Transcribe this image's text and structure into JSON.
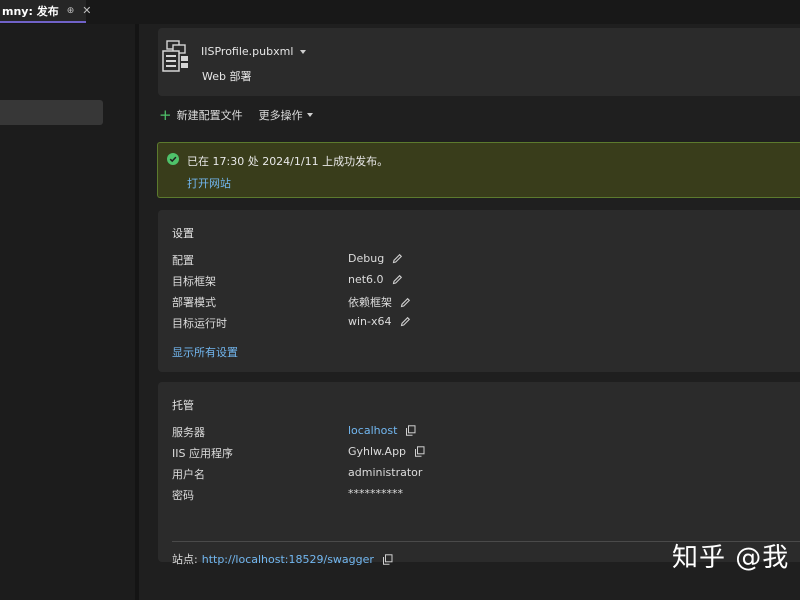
{
  "tab": {
    "title": "mny: 发布",
    "pin_glyph": "⊕",
    "close_glyph": "✕"
  },
  "profile": {
    "name": "IISProfile.pubxml",
    "subtitle": "Web 部署"
  },
  "toolbar": {
    "new_profile_label": "新建配置文件",
    "more_actions_label": "更多操作"
  },
  "status": {
    "message": "已在 17:30 处 2024/1/11 上成功发布。",
    "link_label": "打开网站",
    "color": "#4fc26a"
  },
  "settings": {
    "title": "设置",
    "rows": [
      {
        "label": "配置",
        "value": "Debug"
      },
      {
        "label": "目标框架",
        "value": "net6.0"
      },
      {
        "label": "部署模式",
        "value": "依赖框架"
      },
      {
        "label": "目标运行时",
        "value": "win-x64"
      }
    ],
    "show_all_label": "显示所有设置"
  },
  "hosting": {
    "title": "托管",
    "rows": [
      {
        "label": "服务器",
        "value": "localhost"
      },
      {
        "label": "IIS 应用程序",
        "value": "Gyhlw.App"
      },
      {
        "label": "用户名",
        "value": "administrator"
      },
      {
        "label": "密码",
        "value": "**********"
      }
    ],
    "site_label": "站点:",
    "site_url": "http://localhost:18529/swagger"
  },
  "watermark": "知乎 @我",
  "colors": {
    "accent": "#7062c8",
    "link": "#72b7f0",
    "success_bg": "#393d1b",
    "success_border": "#5c7a2e",
    "card_bg": "#2b2b2b"
  },
  "icons": {
    "profile": "server-icon",
    "status": "check-circle-icon",
    "edit": "pencil-icon",
    "copy": "copy-icon",
    "add": "plus-icon",
    "more": "chevron-down-icon"
  }
}
